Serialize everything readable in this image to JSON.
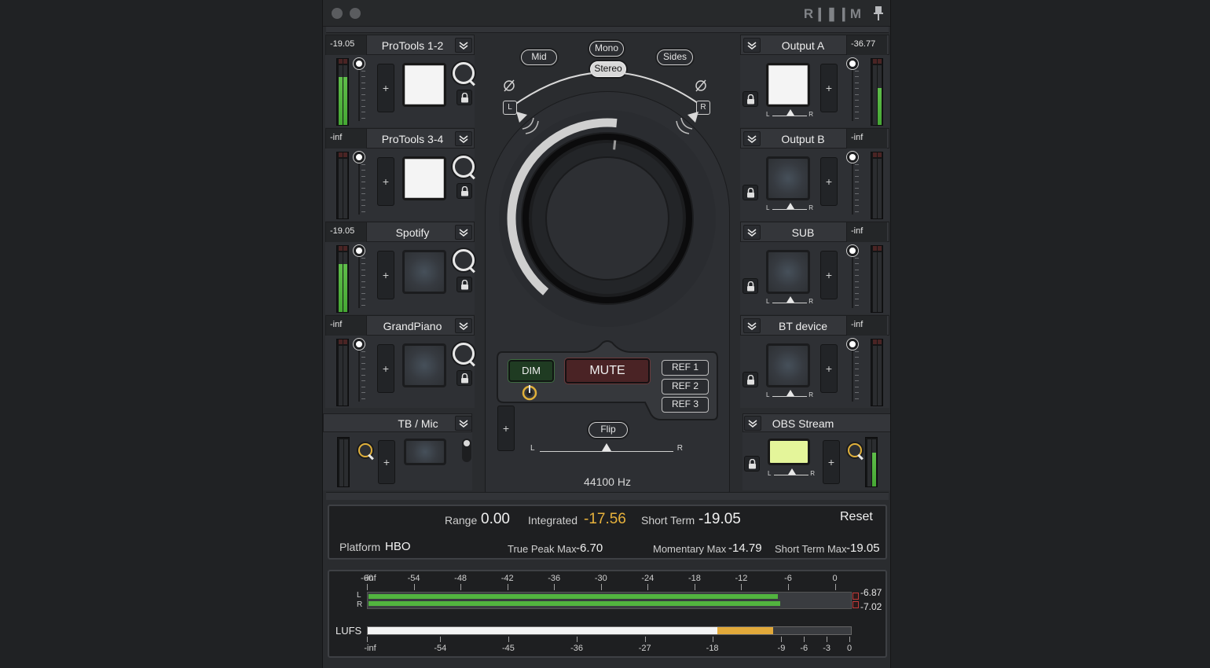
{
  "app": {
    "logo": "R❙❚❙M"
  },
  "channels_left": [
    {
      "value": "-19.05",
      "name": "ProTools 1-2",
      "pad_on": true,
      "meter": [
        0.8,
        0.8
      ]
    },
    {
      "value": "-inf",
      "name": "ProTools 3-4",
      "pad_on": true,
      "meter": [
        0,
        0
      ]
    },
    {
      "value": "-19.05",
      "name": "Spotify",
      "pad_on": false,
      "meter": [
        0.8,
        0.8
      ]
    },
    {
      "value": "-inf",
      "name": "GrandPiano",
      "pad_on": false,
      "meter": [
        0,
        0
      ]
    }
  ],
  "talkback": {
    "name": "TB / Mic"
  },
  "channels_right": [
    {
      "value": "-36.77",
      "name": "Output A",
      "pad_on": true,
      "meter": [
        0,
        0.62
      ]
    },
    {
      "value": "-inf",
      "name": "Output B",
      "pad_on": false,
      "meter": [
        0,
        0
      ]
    },
    {
      "value": "-inf",
      "name": "SUB",
      "pad_on": false,
      "meter": [
        0,
        0
      ]
    },
    {
      "value": "-inf",
      "name": "BT device",
      "pad_on": false,
      "meter": [
        0,
        0
      ]
    }
  ],
  "obs": {
    "name": "OBS Stream",
    "meter": [
      0,
      0.72
    ]
  },
  "center": {
    "modes": {
      "mid": "Mid",
      "mono": "Mono",
      "sides": "Sides",
      "stereo": "Stereo",
      "selected": "Stereo"
    },
    "speaker_left": "L",
    "speaker_right": "R",
    "volume_fraction": 0.56,
    "dim": "DIM",
    "mute": "MUTE",
    "refs": [
      "REF 1",
      "REF 2",
      "REF 3"
    ],
    "flip": "Flip",
    "balance_l": "L",
    "balance_r": "R",
    "sample_rate": "44100 Hz"
  },
  "loudness": {
    "range_label": "Range",
    "range_value": "0.00",
    "integrated_label": "Integrated",
    "integrated_value": "-17.56",
    "short_term_label": "Short Term",
    "short_term_value": "-19.05",
    "reset": "Reset",
    "platform_label": "Platform",
    "platform_value": "HBO",
    "true_peak_label": "True Peak Max",
    "true_peak_value": "-6.70",
    "momentary_label": "Momentary Max",
    "momentary_value": "-14.79",
    "short_term_max_label": "Short Term Max",
    "short_term_max_value": "-19.05"
  },
  "meter_panel": {
    "top_scale": [
      "-inf",
      "-60",
      "-54",
      "-48",
      "-42",
      "-36",
      "-30",
      "-24",
      "-18",
      "-12",
      "-6",
      "0"
    ],
    "bottom_scale": [
      "-inf",
      "-54",
      "-45",
      "-36",
      "-27",
      "-18",
      "-9",
      "-6",
      "-3",
      "0"
    ],
    "l_label": "L",
    "r_label": "R",
    "l_peak": "-6.87",
    "r_peak": "-7.02",
    "l_level_db": -7.5,
    "r_level_db": -7.2,
    "lufs_label": "LUFS",
    "lufs_white_db": -17.5,
    "lufs_orange_db": -10.2
  },
  "colors": {
    "meter_green": "#52b43f",
    "orange": "#e2a93a",
    "obs_pad": "#e4f59a"
  }
}
